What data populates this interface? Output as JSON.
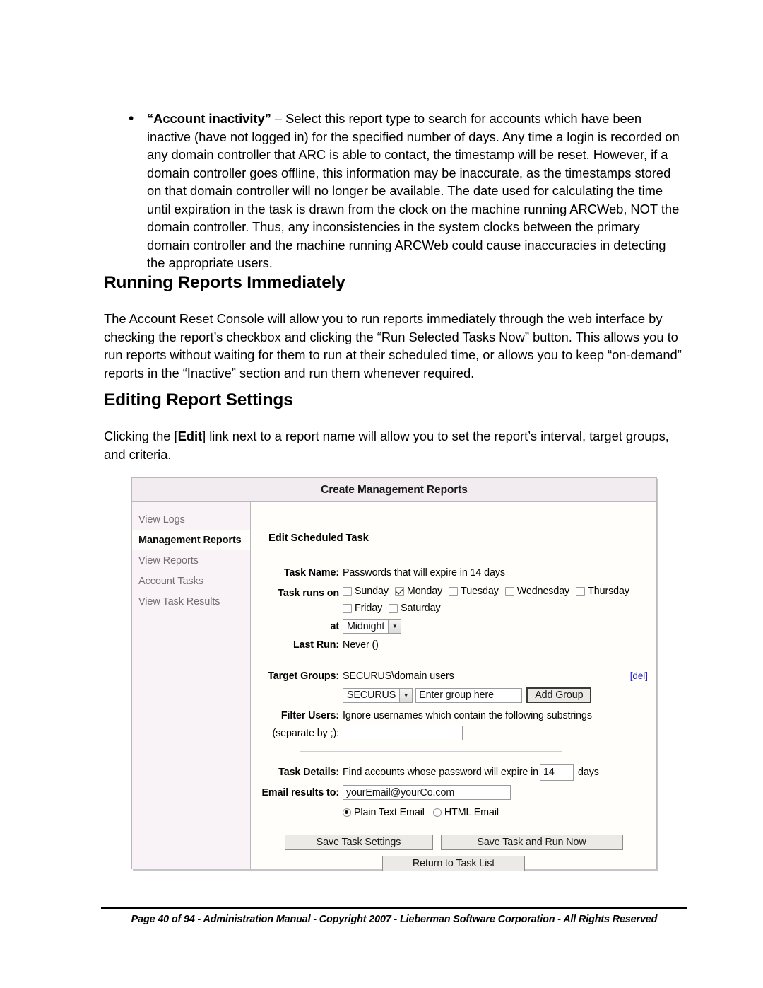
{
  "document": {
    "bullet": {
      "marker": "•",
      "lead_bold": "“Account inactivity”",
      "text": " – Select this report type to search for accounts which have been inactive (have not logged in) for the specified number of days.  Any time a login is recorded on any domain controller that ARC is able to contact, the timestamp will be reset.  However, if a domain controller goes offline, this information may be inaccurate, as the timestamps stored on that domain controller will no longer be available.  The date used for calculating the time until expiration in the task is drawn from the clock on the machine running ARCWeb, NOT the domain controller.  Thus, any inconsistencies in the system clocks between the primary domain controller and the machine running ARCWeb could cause inaccuracies in detecting the appropriate users."
    },
    "heading_running": "Running Reports Immediately",
    "para_running": "The Account Reset Console will allow you to run reports immediately through the web interface by checking the report’s checkbox and clicking the “Run Selected Tasks Now” button.  This allows you to run reports without waiting for them to run at their scheduled time, or allows you to keep “on-demand” reports in the “Inactive” section and run them whenever required.",
    "heading_editing": "Editing Report Settings",
    "para_editing_1": "Clicking the [",
    "para_editing_bold": "Edit",
    "para_editing_2": "] link next to a report name will allow you to set the report’s interval, target groups, and criteria."
  },
  "screenshot": {
    "title": "Create Management Reports",
    "sidebar": {
      "items": [
        {
          "label": "View Logs",
          "active": false
        },
        {
          "label": "Management Reports",
          "active": true
        },
        {
          "label": "View Reports",
          "active": false
        },
        {
          "label": "Account Tasks",
          "active": false
        },
        {
          "label": "View Task Results",
          "active": false
        }
      ]
    },
    "form": {
      "section_title": "Edit Scheduled Task",
      "task_name_label": "Task Name:",
      "task_name_value": "Passwords that will expire in 14 days",
      "task_runs_on_label": "Task runs on",
      "days": [
        {
          "label": "Sunday",
          "checked": false
        },
        {
          "label": "Monday",
          "checked": true
        },
        {
          "label": "Tuesday",
          "checked": false
        },
        {
          "label": "Wednesday",
          "checked": false
        },
        {
          "label": "Thursday",
          "checked": false
        },
        {
          "label": "Friday",
          "checked": false
        },
        {
          "label": "Saturday",
          "checked": false
        }
      ],
      "at_label": "at",
      "at_value": "Midnight",
      "last_run_label": "Last Run:",
      "last_run_value": "Never  ()",
      "target_groups_label": "Target Groups:",
      "target_groups_value": "SECURUS\\domain users",
      "del_link": "[del]",
      "domain_value": "SECURUS",
      "group_input_value": "Enter group here",
      "add_group_button": "Add Group",
      "filter_users_label": "Filter Users:",
      "filter_users_value": "Ignore usernames which contain the following substrings",
      "separate_by_label": "(separate by ;):",
      "separate_by_value": "",
      "task_details_label": "Task Details:",
      "task_details_prefix": "Find accounts whose password will expire in",
      "task_details_days": "14",
      "task_details_suffix": "days",
      "email_results_label": "Email results to:",
      "email_results_value": "yourEmail@yourCo.com",
      "radio_plain": "Plain Text Email",
      "radio_html": "HTML Email",
      "radio_selected": "plain",
      "button_save": "Save Task Settings",
      "button_save_run": "Save Task and Run Now",
      "button_return": "Return to Task List"
    },
    "colors": {
      "title_bar": "#f2ecf0",
      "sidebar": "#f9f2f6",
      "link": "#1f19d8",
      "border": "#b9b9bd"
    }
  },
  "footer": {
    "text": "Page 40 of 94 - Administration Manual - Copyright 2007 - Lieberman Software Corporation - All Rights Reserved"
  }
}
